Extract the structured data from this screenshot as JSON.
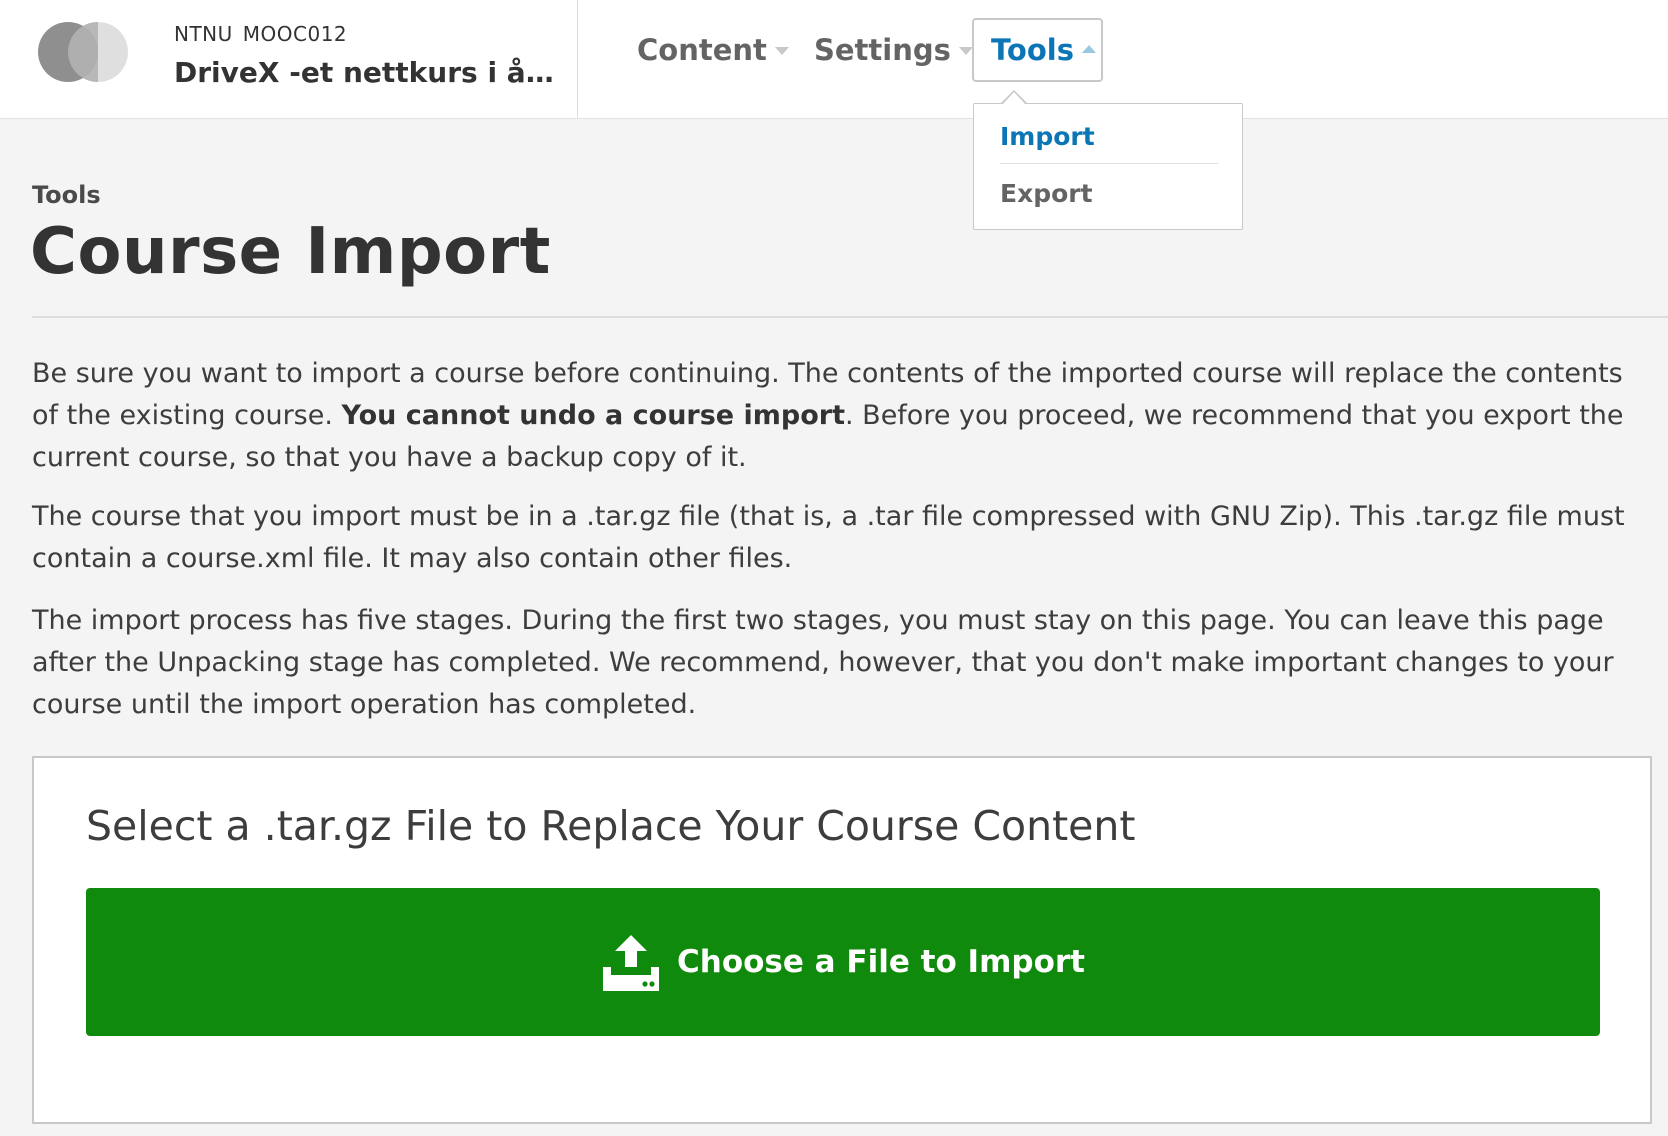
{
  "header": {
    "course_org": "NTNU",
    "course_number": "MOOC012",
    "course_title": "DriveX -et nettkurs i å lage",
    "nav": {
      "content_label": "Content",
      "settings_label": "Settings",
      "tools_label": "Tools"
    },
    "tools_menu": {
      "items": [
        "Import",
        "Export"
      ]
    }
  },
  "page": {
    "breadcrumb": "Tools",
    "title": "Course Import",
    "intro_1_pre": "Be sure you want to import a course before continuing. The contents of the imported course will replace the contents of the existing course. ",
    "intro_1_bold": "You cannot undo a course import",
    "intro_1_post": ". Before you proceed, we recommend that you export the current course, so that you have a backup copy of it.",
    "intro_2": "The course that you import must be in a .tar.gz file (that is, a .tar file compressed with GNU Zip). This .tar.gz file must contain a course.xml file. It may also contain other files.",
    "intro_3": "The import process has five stages. During the first two stages, you must stay on this page. You can leave this page after the Unpacking stage has completed. We recommend, however, that you don't make important changes to your course until the import operation has completed."
  },
  "upload": {
    "panel_title": "Select a .tar.gz File to Replace Your Course Content",
    "button_label": "Choose a File to Import",
    "button_icon": "upload-icon"
  },
  "colors": {
    "accent": "#0b75b5",
    "button_green": "#108a0c",
    "page_bg": "#f4f4f4"
  }
}
